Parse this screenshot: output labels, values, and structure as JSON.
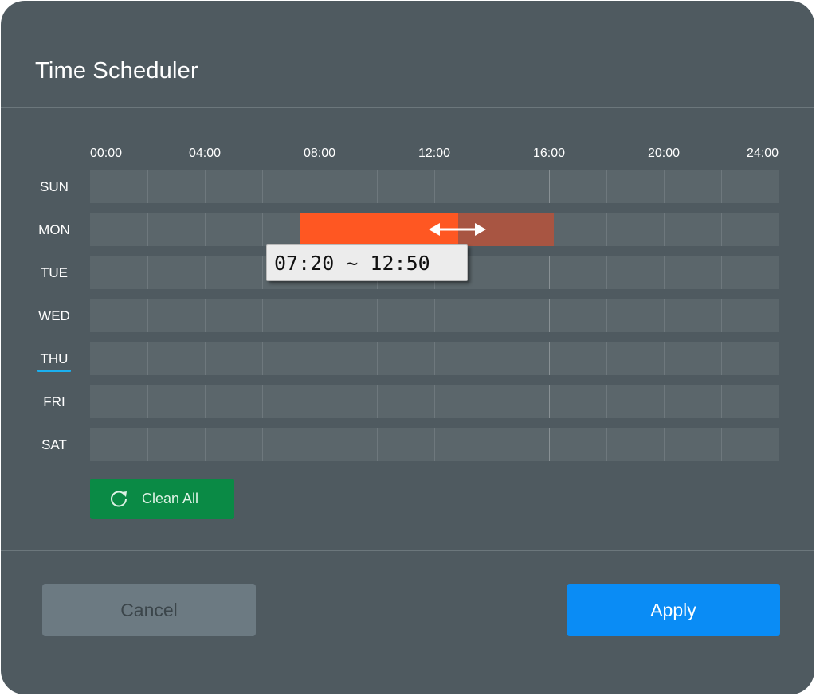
{
  "dialog": {
    "title": "Time Scheduler"
  },
  "hours": [
    "00:00",
    "04:00",
    "08:00",
    "12:00",
    "16:00",
    "20:00",
    "24:00"
  ],
  "days": [
    {
      "key": "sun",
      "label": "SUN",
      "active": false
    },
    {
      "key": "mon",
      "label": "MON",
      "active": false
    },
    {
      "key": "tue",
      "label": "TUE",
      "active": false
    },
    {
      "key": "wed",
      "label": "WED",
      "active": false
    },
    {
      "key": "thu",
      "label": "THU",
      "active": true
    },
    {
      "key": "fri",
      "label": "FRI",
      "active": false
    },
    {
      "key": "sat",
      "label": "SAT",
      "active": false
    }
  ],
  "schedule": {
    "selected": [
      {
        "day": "mon",
        "start_hour": 7.33,
        "end_hour": 12.83
      }
    ],
    "drag_preview": [
      {
        "day": "mon",
        "start_hour": 12.83,
        "end_hour": 16.17
      }
    ]
  },
  "tooltip": {
    "text": "07:20 ~ 12:50"
  },
  "clean_button": {
    "label": "Clean All",
    "icon": "refresh-icon"
  },
  "footer": {
    "cancel_label": "Cancel",
    "apply_label": "Apply"
  },
  "colors": {
    "selected": "#ff5722",
    "preview": "#a85542",
    "clean_button": "#0a8a45",
    "apply_button": "#0a8cf5",
    "active_day_underline": "#1ab0f0"
  }
}
